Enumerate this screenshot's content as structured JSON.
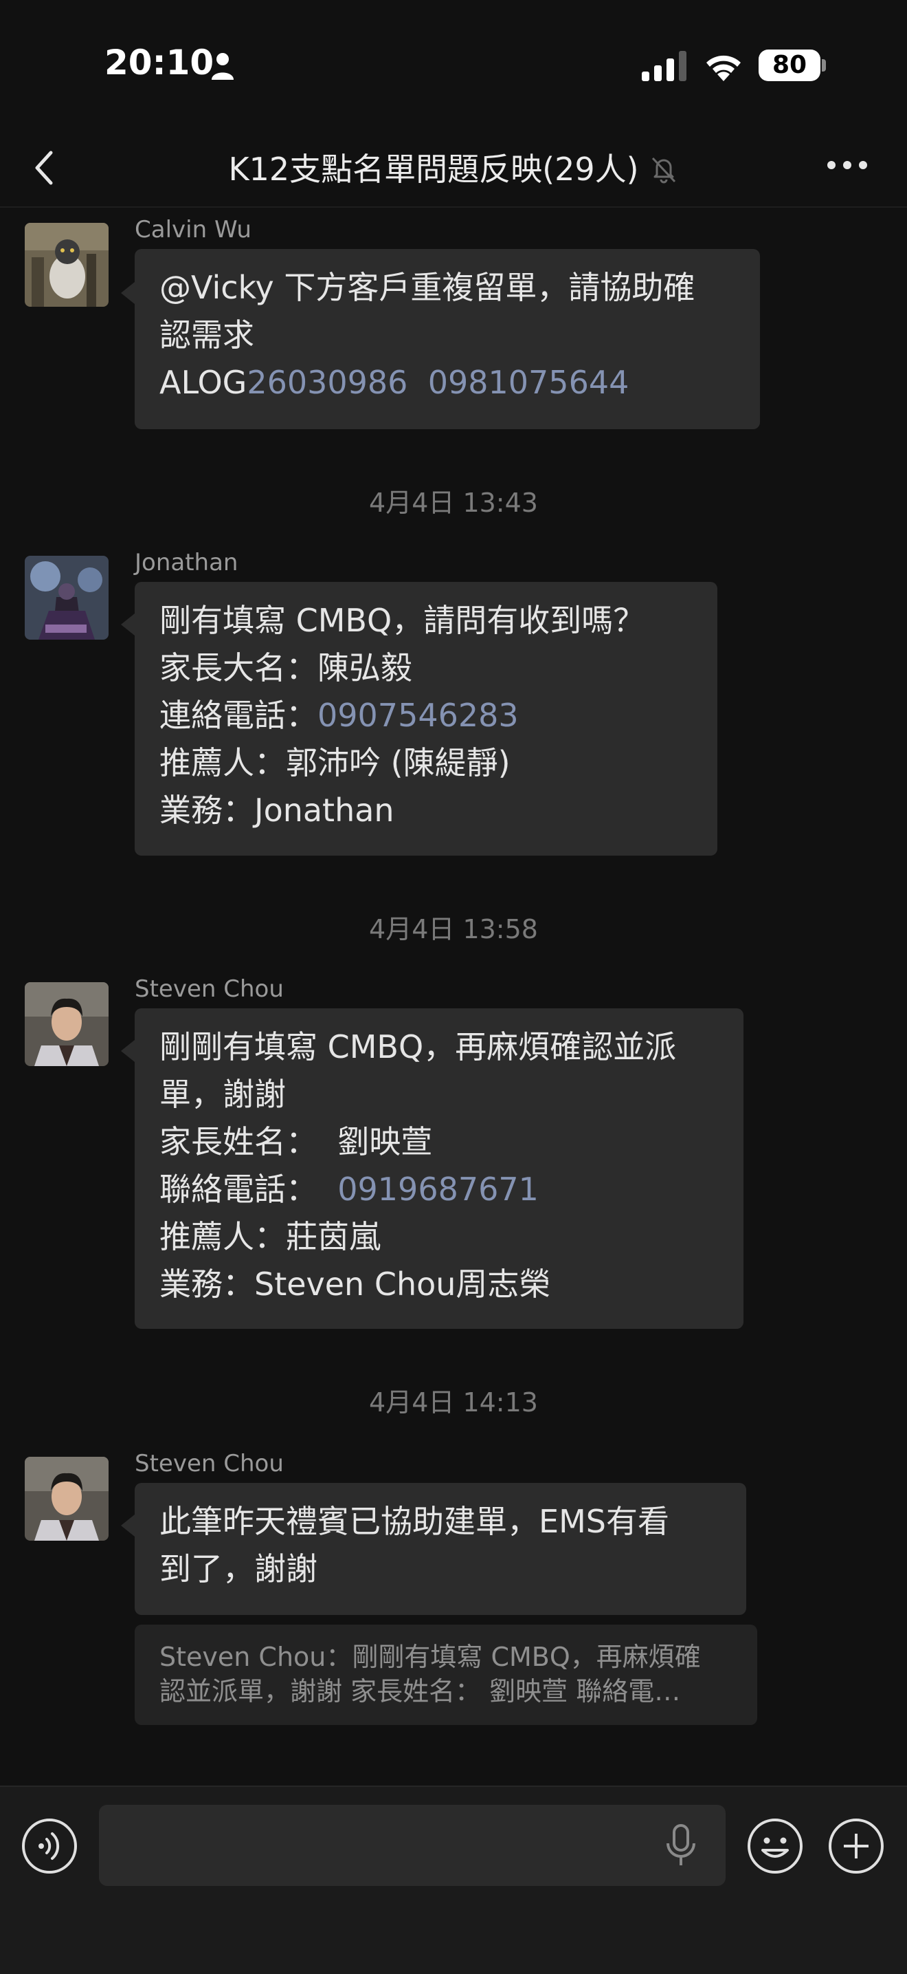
{
  "status_bar": {
    "time": "20:10",
    "battery": "80"
  },
  "header": {
    "title": "K12支點名單問題反映(29人)"
  },
  "messages": [
    {
      "sender": "Calvin Wu",
      "lines": [
        [
          {
            "text": "@Vicky 下方客戶重複留單，請協助確"
          }
        ],
        [
          {
            "text": "認需求"
          }
        ],
        [
          {
            "text": "ALOG"
          },
          {
            "text": "26030986",
            "link": true
          },
          {
            "text": "  "
          },
          {
            "text": "0981075644",
            "link": true
          }
        ]
      ]
    },
    {
      "timestamp": "4月4日 13:43",
      "sender": "Jonathan",
      "lines": [
        [
          {
            "text": "剛有填寫 CMBQ，請問有收到嗎？"
          }
        ],
        [
          {
            "text": "家長大名：陳弘毅"
          }
        ],
        [
          {
            "text": "連絡電話："
          },
          {
            "text": "0907546283",
            "link": true
          }
        ],
        [
          {
            "text": "推薦人：郭沛吟 (陳緹靜)"
          }
        ],
        [
          {
            "text": "業務：Jonathan"
          }
        ]
      ]
    },
    {
      "timestamp": "4月4日 13:58",
      "sender": "Steven Chou",
      "lines": [
        [
          {
            "text": "剛剛有填寫 CMBQ，再麻煩確認並派"
          }
        ],
        [
          {
            "text": "單，謝謝"
          }
        ],
        [
          {
            "text": "家長姓名：  劉映萱"
          }
        ],
        [
          {
            "text": "聯絡電話：  "
          },
          {
            "text": "0919687671",
            "link": true
          }
        ],
        [
          {
            "text": "推薦人：莊茵嵐"
          }
        ],
        [
          {
            "text": "業務：Steven Chou周志榮"
          }
        ]
      ]
    },
    {
      "timestamp": "4月4日 14:13",
      "sender": "Steven Chou",
      "lines": [
        [
          {
            "text": "此筆昨天禮賓已協助建單，EMS有看"
          }
        ],
        [
          {
            "text": "到了，謝謝"
          }
        ]
      ],
      "quote": [
        "Steven Chou：剛剛有填寫 CMBQ，再麻煩確",
        "認並派單，謝謝 家長姓名：  劉映萱 聯絡電…"
      ]
    }
  ],
  "input": {
    "value": "",
    "placeholder": ""
  },
  "colors": {
    "background": "#111111",
    "bubble": "#2c2c2c",
    "link": "#8593b3",
    "timestamp": "#7a7a7a"
  }
}
